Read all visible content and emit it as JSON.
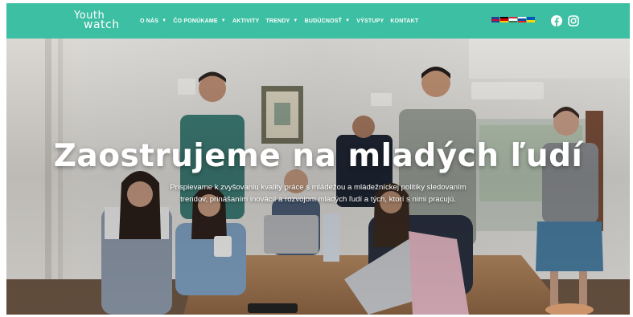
{
  "brand": {
    "line1": "Youth",
    "line2": "watch"
  },
  "nav": {
    "items": [
      {
        "label": "O NÁS",
        "dropdown": true
      },
      {
        "label": "ČO PONÚKAME",
        "dropdown": true
      },
      {
        "label": "AKTIVITY",
        "dropdown": false
      },
      {
        "label": "TRENDY",
        "dropdown": true
      },
      {
        "label": "BUDÚCNOSŤ",
        "dropdown": true
      },
      {
        "label": "VÝSTUPY",
        "dropdown": false
      },
      {
        "label": "KONTAKT",
        "dropdown": false
      }
    ],
    "caret_glyph": "▼",
    "languages": [
      "en",
      "de",
      "hu",
      "sk",
      "ua"
    ],
    "social": [
      "facebook-icon",
      "instagram-icon"
    ]
  },
  "hero": {
    "headline": "Zaostrujeme na mladých ľudí",
    "subtitle": "Prispievame k zvyšovaniu kvality práce s mládežou a mládežníckej politiky sledovaním trendov, prinášaním inovácií a rozvojom mladých ľudí a tých, ktorí s nimi pracujú."
  },
  "colors": {
    "nav_bg": "#3dbfa3",
    "text_white": "#ffffff"
  }
}
